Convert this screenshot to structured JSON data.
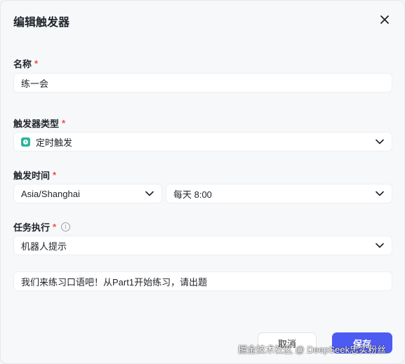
{
  "dialog": {
    "title": "编辑触发器"
  },
  "fields": {
    "name": {
      "label": "名称",
      "required_mark": "*",
      "value": "练一会"
    },
    "trigger_type": {
      "label": "触发器类型",
      "required_mark": "*",
      "value": "定时触发",
      "icon": "clock-icon"
    },
    "trigger_time": {
      "label": "触发时间",
      "required_mark": "*",
      "timezone": "Asia/Shanghai",
      "schedule": "每天 8:00"
    },
    "task": {
      "label": "任务执行",
      "required_mark": "*",
      "info_icon": "i",
      "value": "机器人提示"
    },
    "prompt": {
      "value": "我们来练习口语吧！从Part1开始练习，请出题"
    }
  },
  "buttons": {
    "cancel_label": "取消",
    "save_label": "保存"
  },
  "watermark": "掘金技术社区 @ DeepSeek忠实粉丝",
  "colors": {
    "primary": "#4e5bf2",
    "required": "#e8503a",
    "trigger_icon": "#2bb59a"
  }
}
